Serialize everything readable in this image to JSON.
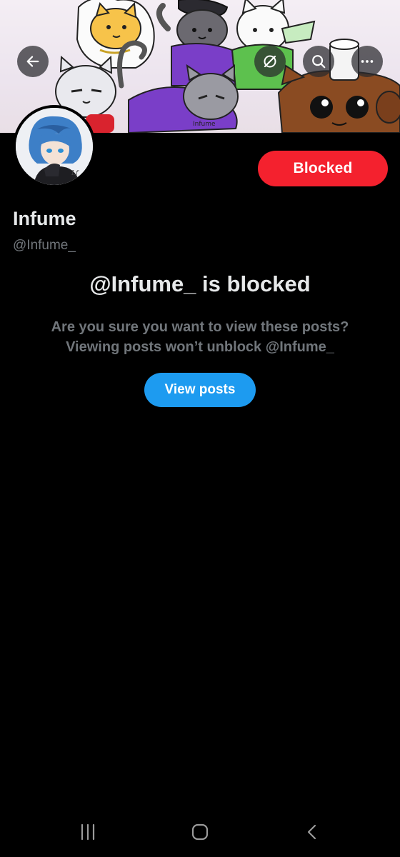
{
  "header": {
    "back_icon": "arrow-left-icon",
    "grok_icon": "grok-icon",
    "search_icon": "search-icon",
    "more_icon": "more-horizontal-icon"
  },
  "banner": {
    "art_text": "Infume"
  },
  "profile": {
    "display_name": "Infume",
    "handle": "@Infume_",
    "relationship_button_label": "Blocked"
  },
  "blocked_notice": {
    "title": "@Infume_ is blocked",
    "line1": "Are you sure you want to view these posts?",
    "line2": "Viewing posts won’t unblock @Infume_",
    "view_button_label": "View posts"
  },
  "system_nav": {
    "recents_icon": "recents-icon",
    "home_icon": "home-icon",
    "back_icon": "back-chevron-icon"
  },
  "colors": {
    "background": "#000000",
    "primary_text": "#e7e9ea",
    "secondary_text": "#71767b",
    "blocked_red": "#f4212e",
    "accent_blue": "#1d9bf0"
  }
}
